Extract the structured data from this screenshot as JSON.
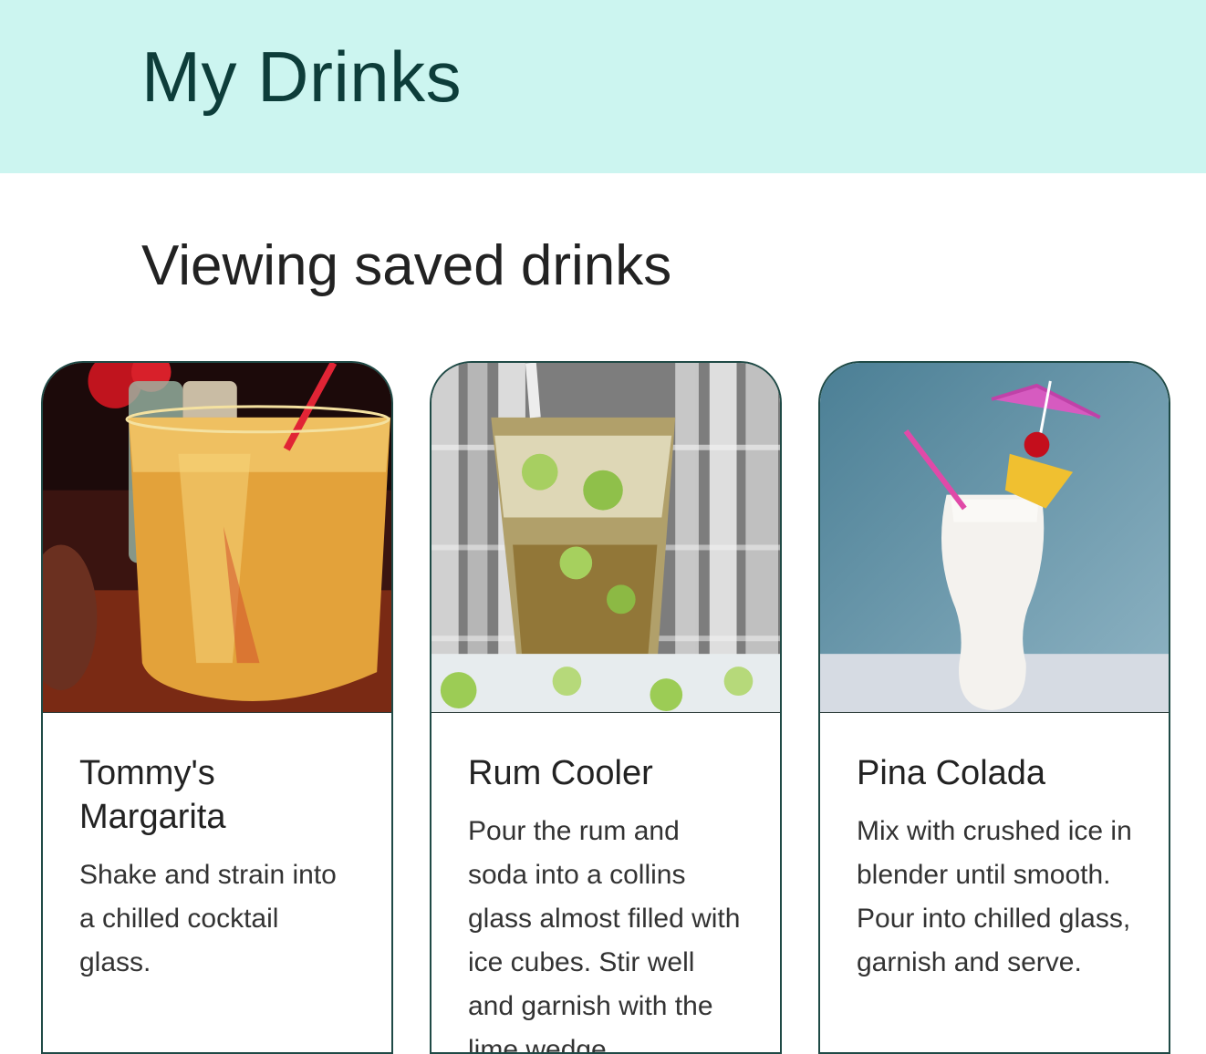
{
  "header": {
    "title": "My Drinks"
  },
  "main": {
    "heading": "Viewing saved drinks",
    "drinks": [
      {
        "name": "Tommy's Margarita",
        "instructions": "Shake and strain into a chilled cocktail glass.",
        "image_icon": "margarita-photo"
      },
      {
        "name": "Rum Cooler",
        "instructions": "Pour the rum and soda into a collins glass almost filled with ice cubes. Stir well and garnish with the lime wedge.",
        "image_icon": "rum-cooler-photo"
      },
      {
        "name": "Pina Colada",
        "instructions": "Mix with crushed ice in blender until smooth. Pour into chilled glass, garnish and serve.",
        "image_icon": "pina-colada-photo"
      }
    ]
  },
  "colors": {
    "header_bg": "#ccf5f0",
    "title": "#0d3d3a",
    "card_border": "#1f4a46"
  }
}
